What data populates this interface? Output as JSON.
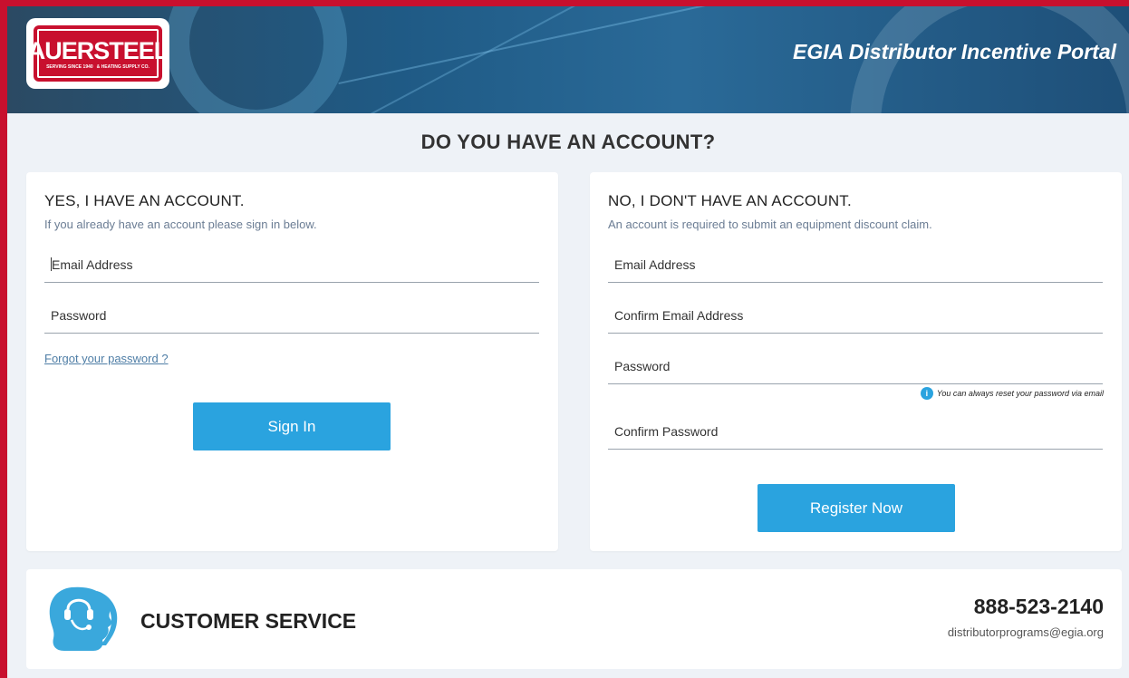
{
  "header": {
    "logo": {
      "text": "AUERSTEEL",
      "tagline_left": "SERVING SINCE 1940",
      "tagline_right": "& HEATING SUPPLY CO."
    },
    "portal_title": "EGIA Distributor Incentive Portal"
  },
  "main": {
    "heading": "DO YOU HAVE AN ACCOUNT?",
    "signin": {
      "title": "YES, I HAVE AN ACCOUNT.",
      "subtitle": "If you already have an account please sign in below.",
      "email_placeholder": "Email Address",
      "password_placeholder": "Password",
      "forgot_link": "Forgot your password ?",
      "button_label": "Sign In"
    },
    "register": {
      "title": "NO, I DON'T HAVE AN ACCOUNT.",
      "subtitle": "An account is required to submit an equipment discount claim.",
      "email_placeholder": "Email Address",
      "confirm_email_placeholder": "Confirm Email Address",
      "password_placeholder": "Password",
      "password_hint": "You can always reset your password via email",
      "confirm_password_placeholder": "Confirm Password",
      "button_label": "Register Now"
    }
  },
  "footer": {
    "label": "CUSTOMER SERVICE",
    "phone": "888-523-2140",
    "email": "distributorprograms@egia.org",
    "icon": "customer-service-headset-icon"
  },
  "colors": {
    "frame": "#c8102e",
    "button": "#2aa3df",
    "link": "#4f7ea6",
    "background": "#eef2f7"
  }
}
